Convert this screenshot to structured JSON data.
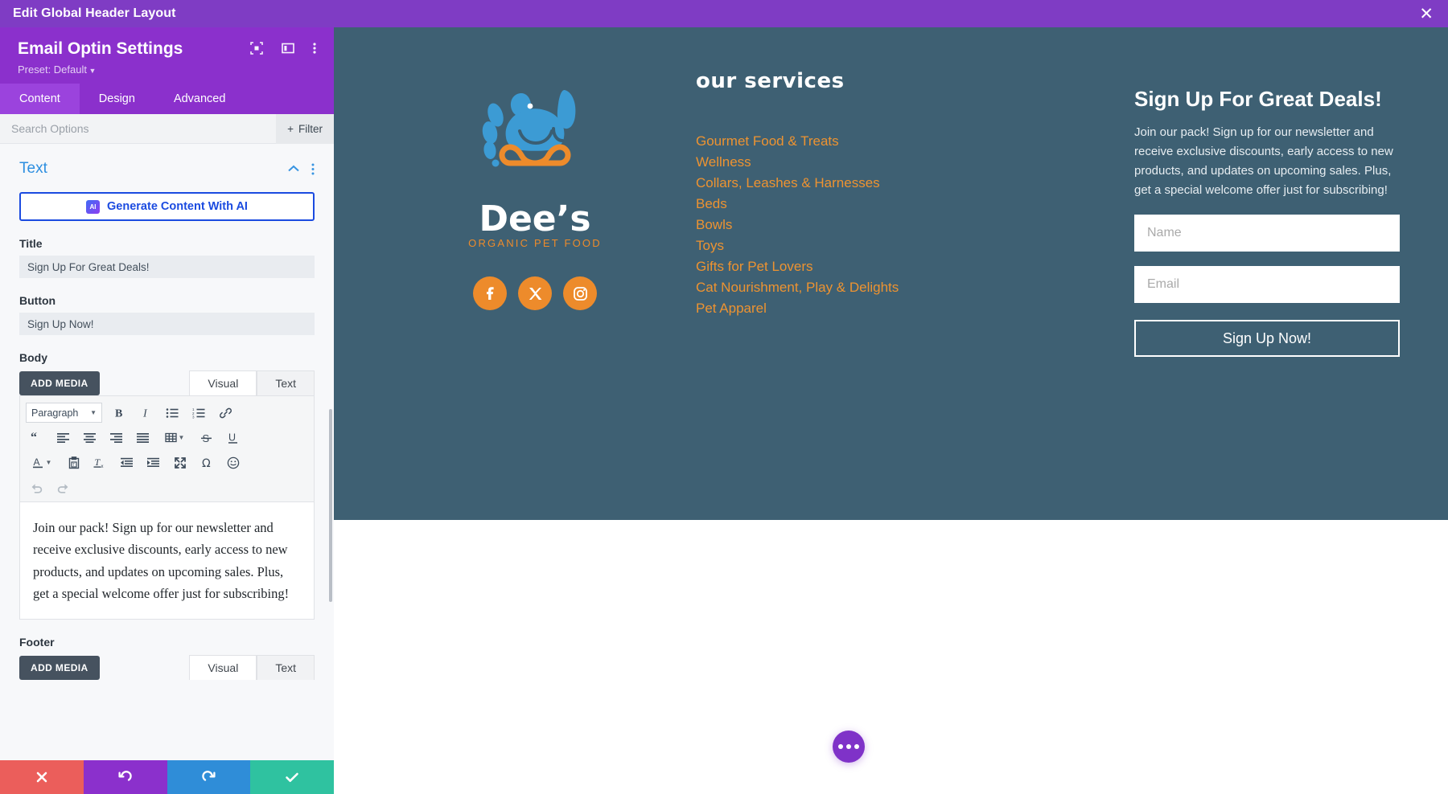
{
  "titlebar": {
    "text": "Edit Global Header Layout",
    "close_icon": "close-icon"
  },
  "panel": {
    "title": "Email Optin Settings",
    "preset": "Preset: Default",
    "icons": [
      "responsive-view-icon",
      "layout-view-icon",
      "more-options-icon"
    ],
    "tabs": [
      {
        "label": "Content",
        "active": true
      },
      {
        "label": "Design",
        "active": false
      },
      {
        "label": "Advanced",
        "active": false
      }
    ],
    "search": {
      "placeholder": "Search Options",
      "value": ""
    },
    "filter_label": "Filter",
    "section": {
      "title": "Text",
      "collapse_icon": "chevron-up-icon",
      "more_icon": "more-options-icon"
    },
    "ai_button": {
      "label": "Generate Content With AI",
      "badge": "AI"
    },
    "fields": {
      "title_label": "Title",
      "title_value": "Sign Up For Great Deals!",
      "button_label": "Button",
      "button_value": "Sign Up Now!",
      "body_label": "Body",
      "footer_label": "Footer"
    },
    "editor": {
      "add_media": "ADD MEDIA",
      "tab_visual": "Visual",
      "tab_text": "Text",
      "format_select": "Paragraph",
      "toolbar_row1": [
        "bold-icon",
        "italic-icon",
        "bulleted-list-icon",
        "numbered-list-icon",
        "link-icon"
      ],
      "toolbar_row2": [
        "blockquote-icon",
        "align-left-icon",
        "align-center-icon",
        "align-right-icon",
        "align-justify-icon",
        "table-icon",
        "strikethrough-icon",
        "underline-icon"
      ],
      "toolbar_row3": [
        "text-color-icon",
        "paste-as-text-icon",
        "clear-formatting-icon",
        "outdent-icon",
        "indent-icon",
        "fullscreen-icon",
        "special-character-icon",
        "emoji-icon"
      ],
      "toolbar_row4": [
        "undo-icon",
        "redo-icon"
      ],
      "body_text": "Join our pack! Sign up for our newsletter and receive exclusive discounts, early access to new products, and updates on upcoming sales. Plus, get a special welcome offer just for subscribing!"
    },
    "actions": [
      {
        "name": "cancel",
        "icon": "close-icon",
        "color": "#eb5e5b"
      },
      {
        "name": "undo",
        "icon": "undo-icon",
        "color": "#8B30CC"
      },
      {
        "name": "redo",
        "icon": "redo-icon",
        "color": "#2f8dd8"
      },
      {
        "name": "save",
        "icon": "check-icon",
        "color": "#2fc2a0"
      }
    ]
  },
  "preview": {
    "background": "#3e6073",
    "accent": "#ED9331",
    "logo": {
      "name": "Dee's",
      "tagline": "ORGANIC PET FOOD"
    },
    "socials": [
      {
        "name": "facebook-icon",
        "label": "f"
      },
      {
        "name": "x-twitter-icon",
        "label": "X"
      },
      {
        "name": "instagram-icon",
        "label": "IG"
      }
    ],
    "services": {
      "heading": "Our Services",
      "items": [
        "Gourmet Food & Treats",
        "Wellness",
        "Collars, Leashes & Harnesses",
        "Beds",
        "Bowls",
        "Toys",
        "Gifts for Pet Lovers",
        "Cat Nourishment, Play & Delights",
        "Pet Apparel"
      ]
    },
    "optin": {
      "title": "Sign Up For Great Deals!",
      "body": "Join our pack! Sign up for our newsletter and receive exclusive discounts, early access to new products, and updates on upcoming sales. Plus, get a special welcome offer just for subscribing!",
      "name_placeholder": "Name",
      "email_placeholder": "Email",
      "submit_label": "Sign Up Now!"
    },
    "fab_icon": "more-options-icon"
  }
}
